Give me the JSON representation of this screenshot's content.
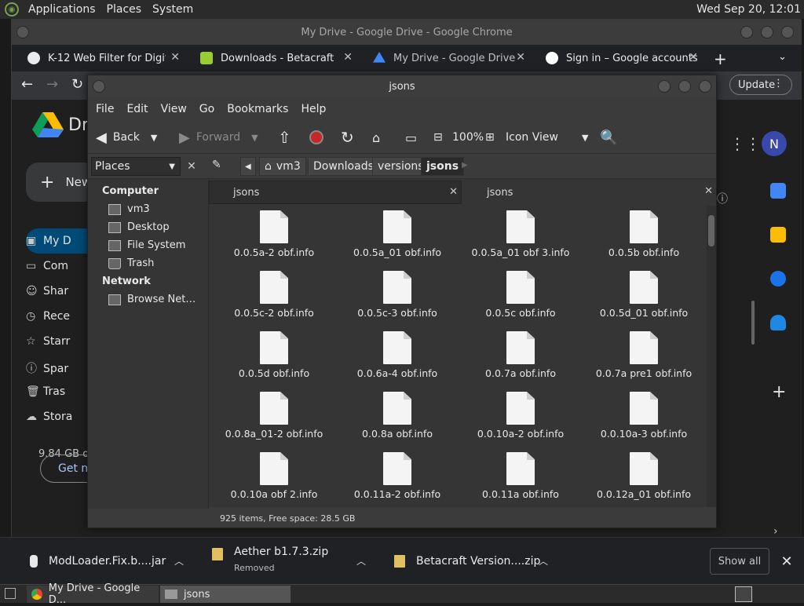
{
  "system": {
    "menus": [
      "Applications",
      "Places",
      "System"
    ],
    "clock": "Wed Sep 20, 12:01"
  },
  "chrome": {
    "title": "My Drive - Google Drive - Google Chrome",
    "tabs": [
      {
        "title": "K-12 Web Filter for Digital",
        "color": "#e8eaed"
      },
      {
        "title": "Downloads - Betacraft",
        "color": "#9acd32"
      },
      {
        "title": "My Drive - Google Drive",
        "color": "#4285f4"
      },
      {
        "title": "Sign in – Google accounts",
        "color": "#ffffff"
      }
    ],
    "update_label": "Update"
  },
  "drive": {
    "logo_text": "Dr",
    "new_label": "New",
    "nav": [
      "My D",
      "Com",
      "Shar",
      "Rece",
      "Starr",
      "Spar",
      "Tras",
      "Stora"
    ],
    "storage_text": "9.84 GB o",
    "get_more_label": "Get m",
    "avatar_letter": "N"
  },
  "fm": {
    "title": "jsons",
    "menu": [
      "File",
      "Edit",
      "View",
      "Go",
      "Bookmarks",
      "Help"
    ],
    "toolbar": {
      "back": "Back",
      "forward": "Forward",
      "zoom": "100%",
      "view_mode": "Icon View"
    },
    "places_label": "Places",
    "breadcrumbs": [
      "vm3",
      "Downloads",
      "versions",
      "jsons"
    ],
    "sidebar": {
      "computer_header": "Computer",
      "computer_items": [
        "vm3",
        "Desktop",
        "File System",
        "Trash"
      ],
      "network_header": "Network",
      "network_items": [
        "Browse Net…"
      ]
    },
    "tabs": [
      "jsons",
      "jsons"
    ],
    "files": [
      "0.0.5a-2 obf.info",
      "0.0.5a_01 obf.info",
      "0.0.5a_01 obf 3.info",
      "0.0.5b obf.info",
      "0.0.5c-2 obf.info",
      "0.0.5c-3 obf.info",
      "0.0.5c obf.info",
      "0.0.5d_01 obf.info",
      "0.0.5d obf.info",
      "0.0.6a-4 obf.info",
      "0.0.7a obf.info",
      "0.0.7a pre1 obf.info",
      "0.0.8a_01-2 obf.info",
      "0.0.8a obf.info",
      "0.0.10a-2 obf.info",
      "0.0.10a-3 obf.info",
      "0.0.10a obf 2.info",
      "0.0.11a-2 obf.info",
      "0.0.11a obf.info",
      "0.0.12a_01 obf.info"
    ],
    "status": "925 items, Free space: 28.5 GB"
  },
  "downloads": {
    "items": [
      {
        "name": "ModLoader.Fix.b....jar",
        "sub": ""
      },
      {
        "name": "Aether b1.7.3.zip",
        "sub": "Removed"
      },
      {
        "name": "Betacraft Version....zip",
        "sub": ""
      }
    ],
    "show_all_label": "Show all"
  },
  "taskbar": {
    "items": [
      "My Drive - Google D...",
      "jsons"
    ]
  }
}
